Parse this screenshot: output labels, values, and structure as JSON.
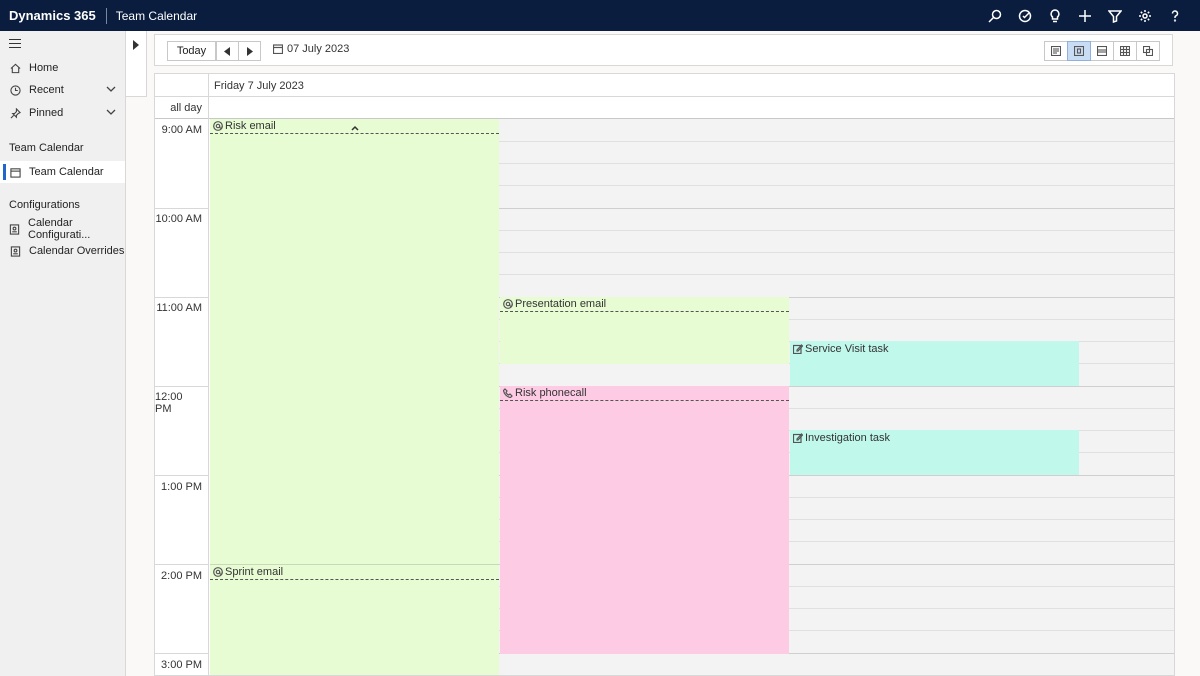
{
  "topbar": {
    "brand": "Dynamics 365",
    "app_title": "Team Calendar",
    "icons": [
      "search-icon",
      "target-icon",
      "lightbulb-icon",
      "plus-icon",
      "filter-icon",
      "gear-icon",
      "help-icon"
    ]
  },
  "sidenav": {
    "items": [
      {
        "label": "Home",
        "icon": "home-icon"
      },
      {
        "label": "Recent",
        "icon": "clock-icon"
      },
      {
        "label": "Pinned",
        "icon": "pin-icon"
      }
    ],
    "section_team": "Team Calendar",
    "team_items": [
      {
        "label": "Team Calendar",
        "icon": "calendar-icon"
      }
    ],
    "section_config": "Configurations",
    "config_items": [
      {
        "label": "Calendar Configurati...",
        "icon": "entity-icon"
      },
      {
        "label": "Calendar Overrides",
        "icon": "entity-icon"
      }
    ]
  },
  "toolbar": {
    "today_label": "Today",
    "date_value": "07 July 2023",
    "views": [
      "list-view-icon",
      "day-view-icon",
      "week-view-icon",
      "month-view-icon",
      "multi-view-icon"
    ],
    "active_view": 1
  },
  "calendar": {
    "day_title": "Friday 7 July 2023",
    "allday_label": "all day",
    "times": [
      "9:00 AM",
      "10:00 AM",
      "11:00 AM",
      "12:00 PM",
      "1:00 PM",
      "2:00 PM",
      "3:00 PM"
    ],
    "events": [
      {
        "title": "Risk email",
        "type": "email",
        "start": "9:00 AM",
        "end": "3:00 PM",
        "color": "#e8fcd4"
      },
      {
        "title": "Sprint email",
        "type": "email",
        "start": "2:00 PM",
        "end": "3:00 PM",
        "color": "#e8fcd4"
      },
      {
        "title": "Presentation email",
        "type": "email",
        "start": "11:00 AM",
        "end": "11:45 AM",
        "color": "#e8fcd4"
      },
      {
        "title": "Service Visit task",
        "type": "task",
        "start": "11:30 AM",
        "end": "12:00 PM",
        "color": "#c1f8ec"
      },
      {
        "title": "Risk phonecall",
        "type": "phonecall",
        "start": "12:00 PM",
        "end": "3:00 PM",
        "color": "#fdcbe4"
      },
      {
        "title": "Investigation task",
        "type": "task",
        "start": "12:30 PM",
        "end": "1:00 PM",
        "color": "#c1f8ec"
      }
    ]
  }
}
